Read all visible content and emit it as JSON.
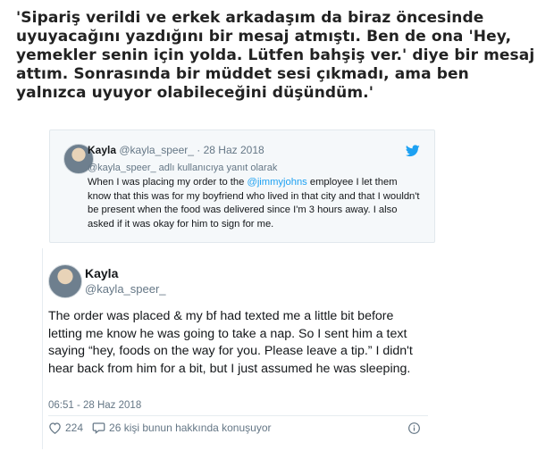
{
  "caption": "'Sipariş verildi ve erkek arkadaşım da biraz öncesinde uyuyacağını yazdığını bir mesaj atmıştı. Ben de ona 'Hey, yemekler senin için yolda. Lütfen bahşiş ver.' diye bir mesaj attım. Sonrasında bir müddet sesi çıkmadı, ama ben yalnızca uyuyor olabileceğini düşündüm.'",
  "quoted_tweet": {
    "name": "Kayla",
    "handle": "@kayla_speer_",
    "separator": "·",
    "date": "28 Haz 2018",
    "reply_to": "@kayla_speer_ adlı kullanıcıya yanıt olarak",
    "text_before": "When I was placing my order to the ",
    "mention": "@jimmyjohns",
    "text_after": " employee I let them know that this was for my boyfriend who lived in that city and that I wouldn't be present when the food was delivered since I'm 3 hours away. I also asked if it was okay for him to sign for me.",
    "icon": "twitter-bird-icon",
    "accent": "#1da1f2"
  },
  "main_tweet": {
    "name": "Kayla",
    "handle": "@kayla_speer_",
    "text": "The order was placed & my bf had texted me a little bit before letting me know he was going to take a nap. So I sent him a text saying “hey, foods on the way for you. Please leave a tip.” I didn't hear back from him for a bit, but I just assumed he was sleeping.",
    "timestamp": "06:51 - 28 Haz 2018",
    "likes": "224",
    "conversation": "26 kişi bunun hakkında konuşuyor",
    "icons": [
      "heart-icon",
      "comment-icon",
      "info-icon"
    ]
  }
}
